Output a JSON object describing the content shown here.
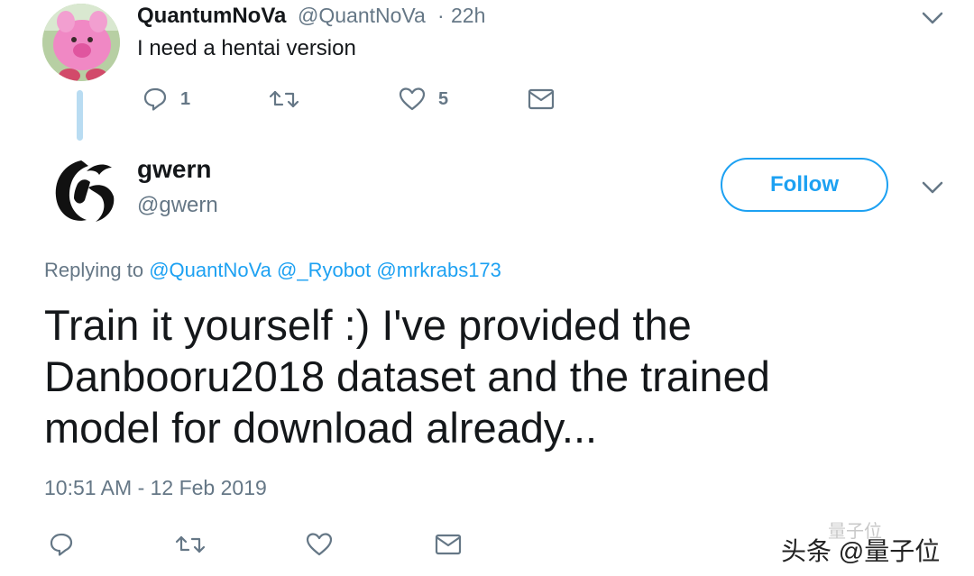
{
  "reply_tweet": {
    "display_name": "QuantumNoVa",
    "handle": "@QuantNoVa",
    "separator": "·",
    "time": "22h",
    "text": "I need a hentai version",
    "actions": {
      "reply_count": "1",
      "retweet_count": "",
      "like_count": "5"
    }
  },
  "main_tweet": {
    "display_name": "gwern",
    "handle": "@gwern",
    "follow_label": "Follow",
    "replying_prefix": "Replying to",
    "replying_mentions": [
      "@QuantNoVa",
      "@_Ryobot",
      "@mrkrabs173"
    ],
    "text_lines": [
      "Train it yourself :) I've provided the",
      "Danbooru2018 dataset and the trained",
      "model for download already..."
    ],
    "timestamp": "10:51 AM - 12 Feb 2019"
  },
  "watermark": {
    "main": "头条 @量子位",
    "faint": "量子位"
  },
  "colors": {
    "accent": "#1da1f2",
    "secondary_text": "#657786",
    "primary_text": "#14171a",
    "thread_line": "#b9dcf2"
  },
  "icons": [
    "reply-icon",
    "retweet-icon",
    "like-icon",
    "message-icon",
    "chevron-down-icon"
  ]
}
